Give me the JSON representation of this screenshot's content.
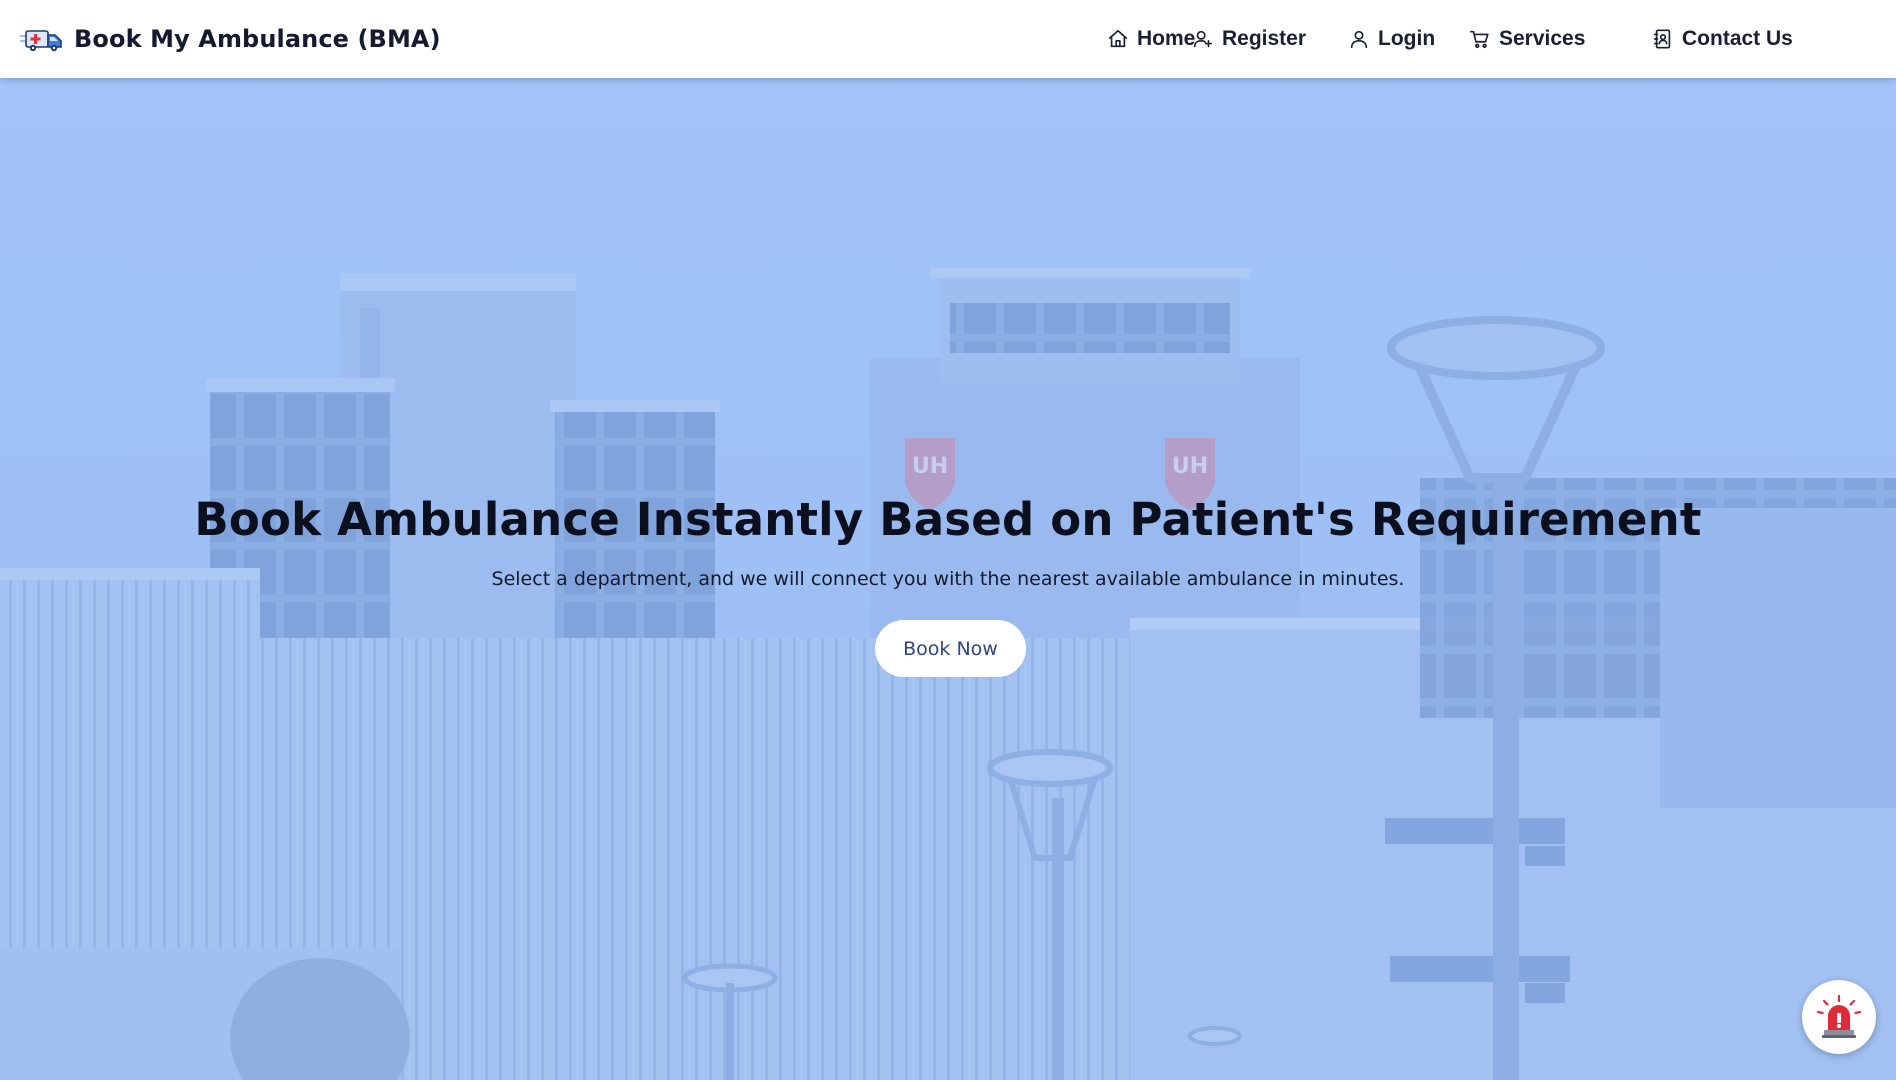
{
  "brand": {
    "name": "Book My Ambulance (BMA)",
    "logo_icon": "ambulance-icon"
  },
  "nav": {
    "items": [
      {
        "label": "Home",
        "icon": "home-icon"
      },
      {
        "label": "Register",
        "icon": "user-plus-icon"
      },
      {
        "label": "Login",
        "icon": "user-icon"
      },
      {
        "label": "Services",
        "icon": "cart-icon"
      },
      {
        "label": "Contact Us",
        "icon": "contact-book-icon"
      }
    ]
  },
  "hero": {
    "title": "Book Ambulance Instantly Based on Patient's Requirement",
    "subtitle": "Select a department, and we will connect you with the nearest available ambulance in minutes.",
    "cta_label": "Book Now",
    "background": "hospital-building-photo",
    "overlay_color": "#9cc0f6"
  },
  "emergency": {
    "icon": "emergency-siren-icon",
    "color": "#e02b3a"
  },
  "colors": {
    "navbar_bg": "#ffffff",
    "text_dark": "#0b0f1e",
    "button_text": "#2e4780"
  }
}
